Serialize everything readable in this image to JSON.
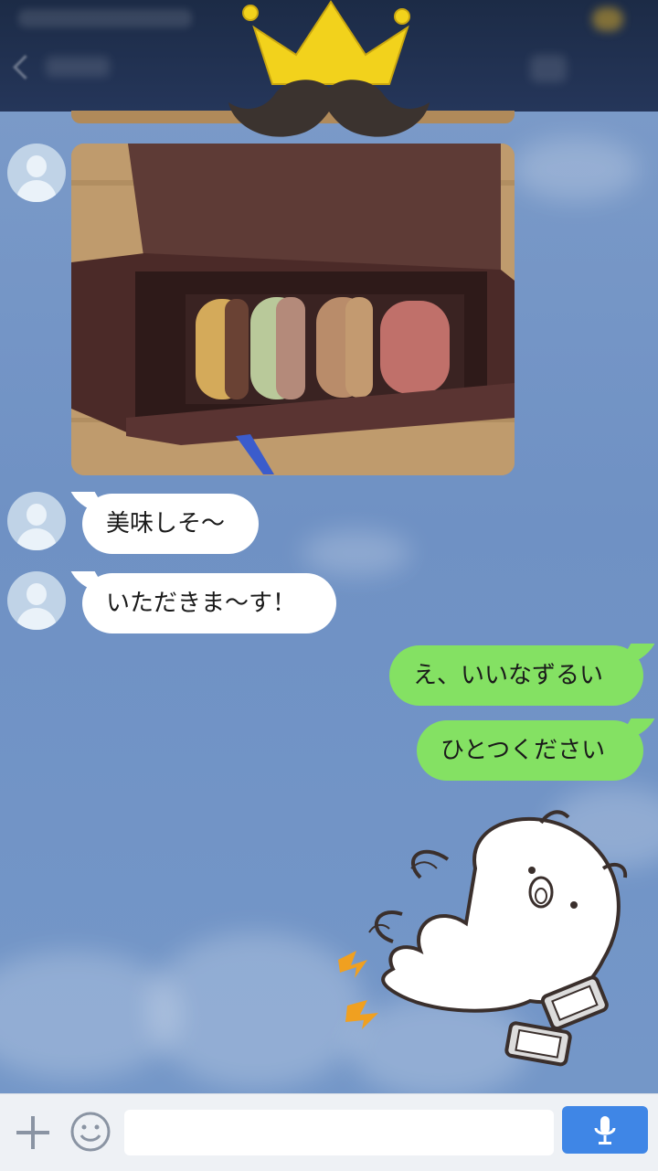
{
  "messages": [
    {
      "type": "image",
      "direction": "in",
      "content": "photo of a box of four macarons"
    },
    {
      "type": "text",
      "direction": "in",
      "text": "美味しそ〜"
    },
    {
      "type": "text",
      "direction": "in",
      "text": "いただきま〜す！"
    },
    {
      "type": "text",
      "direction": "out",
      "text": "え、いいなずるい"
    },
    {
      "type": "text",
      "direction": "out",
      "text": "ひとつください"
    },
    {
      "type": "sticker",
      "direction": "out",
      "content": "white bird character sticker"
    }
  ],
  "input": {
    "placeholder": "",
    "value": ""
  },
  "colors": {
    "header": "#1c2b46",
    "background": "#7598c9",
    "incoming_bubble": "#ffffff",
    "outgoing_bubble": "#84e163",
    "send_button": "#3f86e6"
  },
  "icons": {
    "attach": "plus-icon",
    "emoji": "smile-icon",
    "voice": "microphone-icon"
  }
}
